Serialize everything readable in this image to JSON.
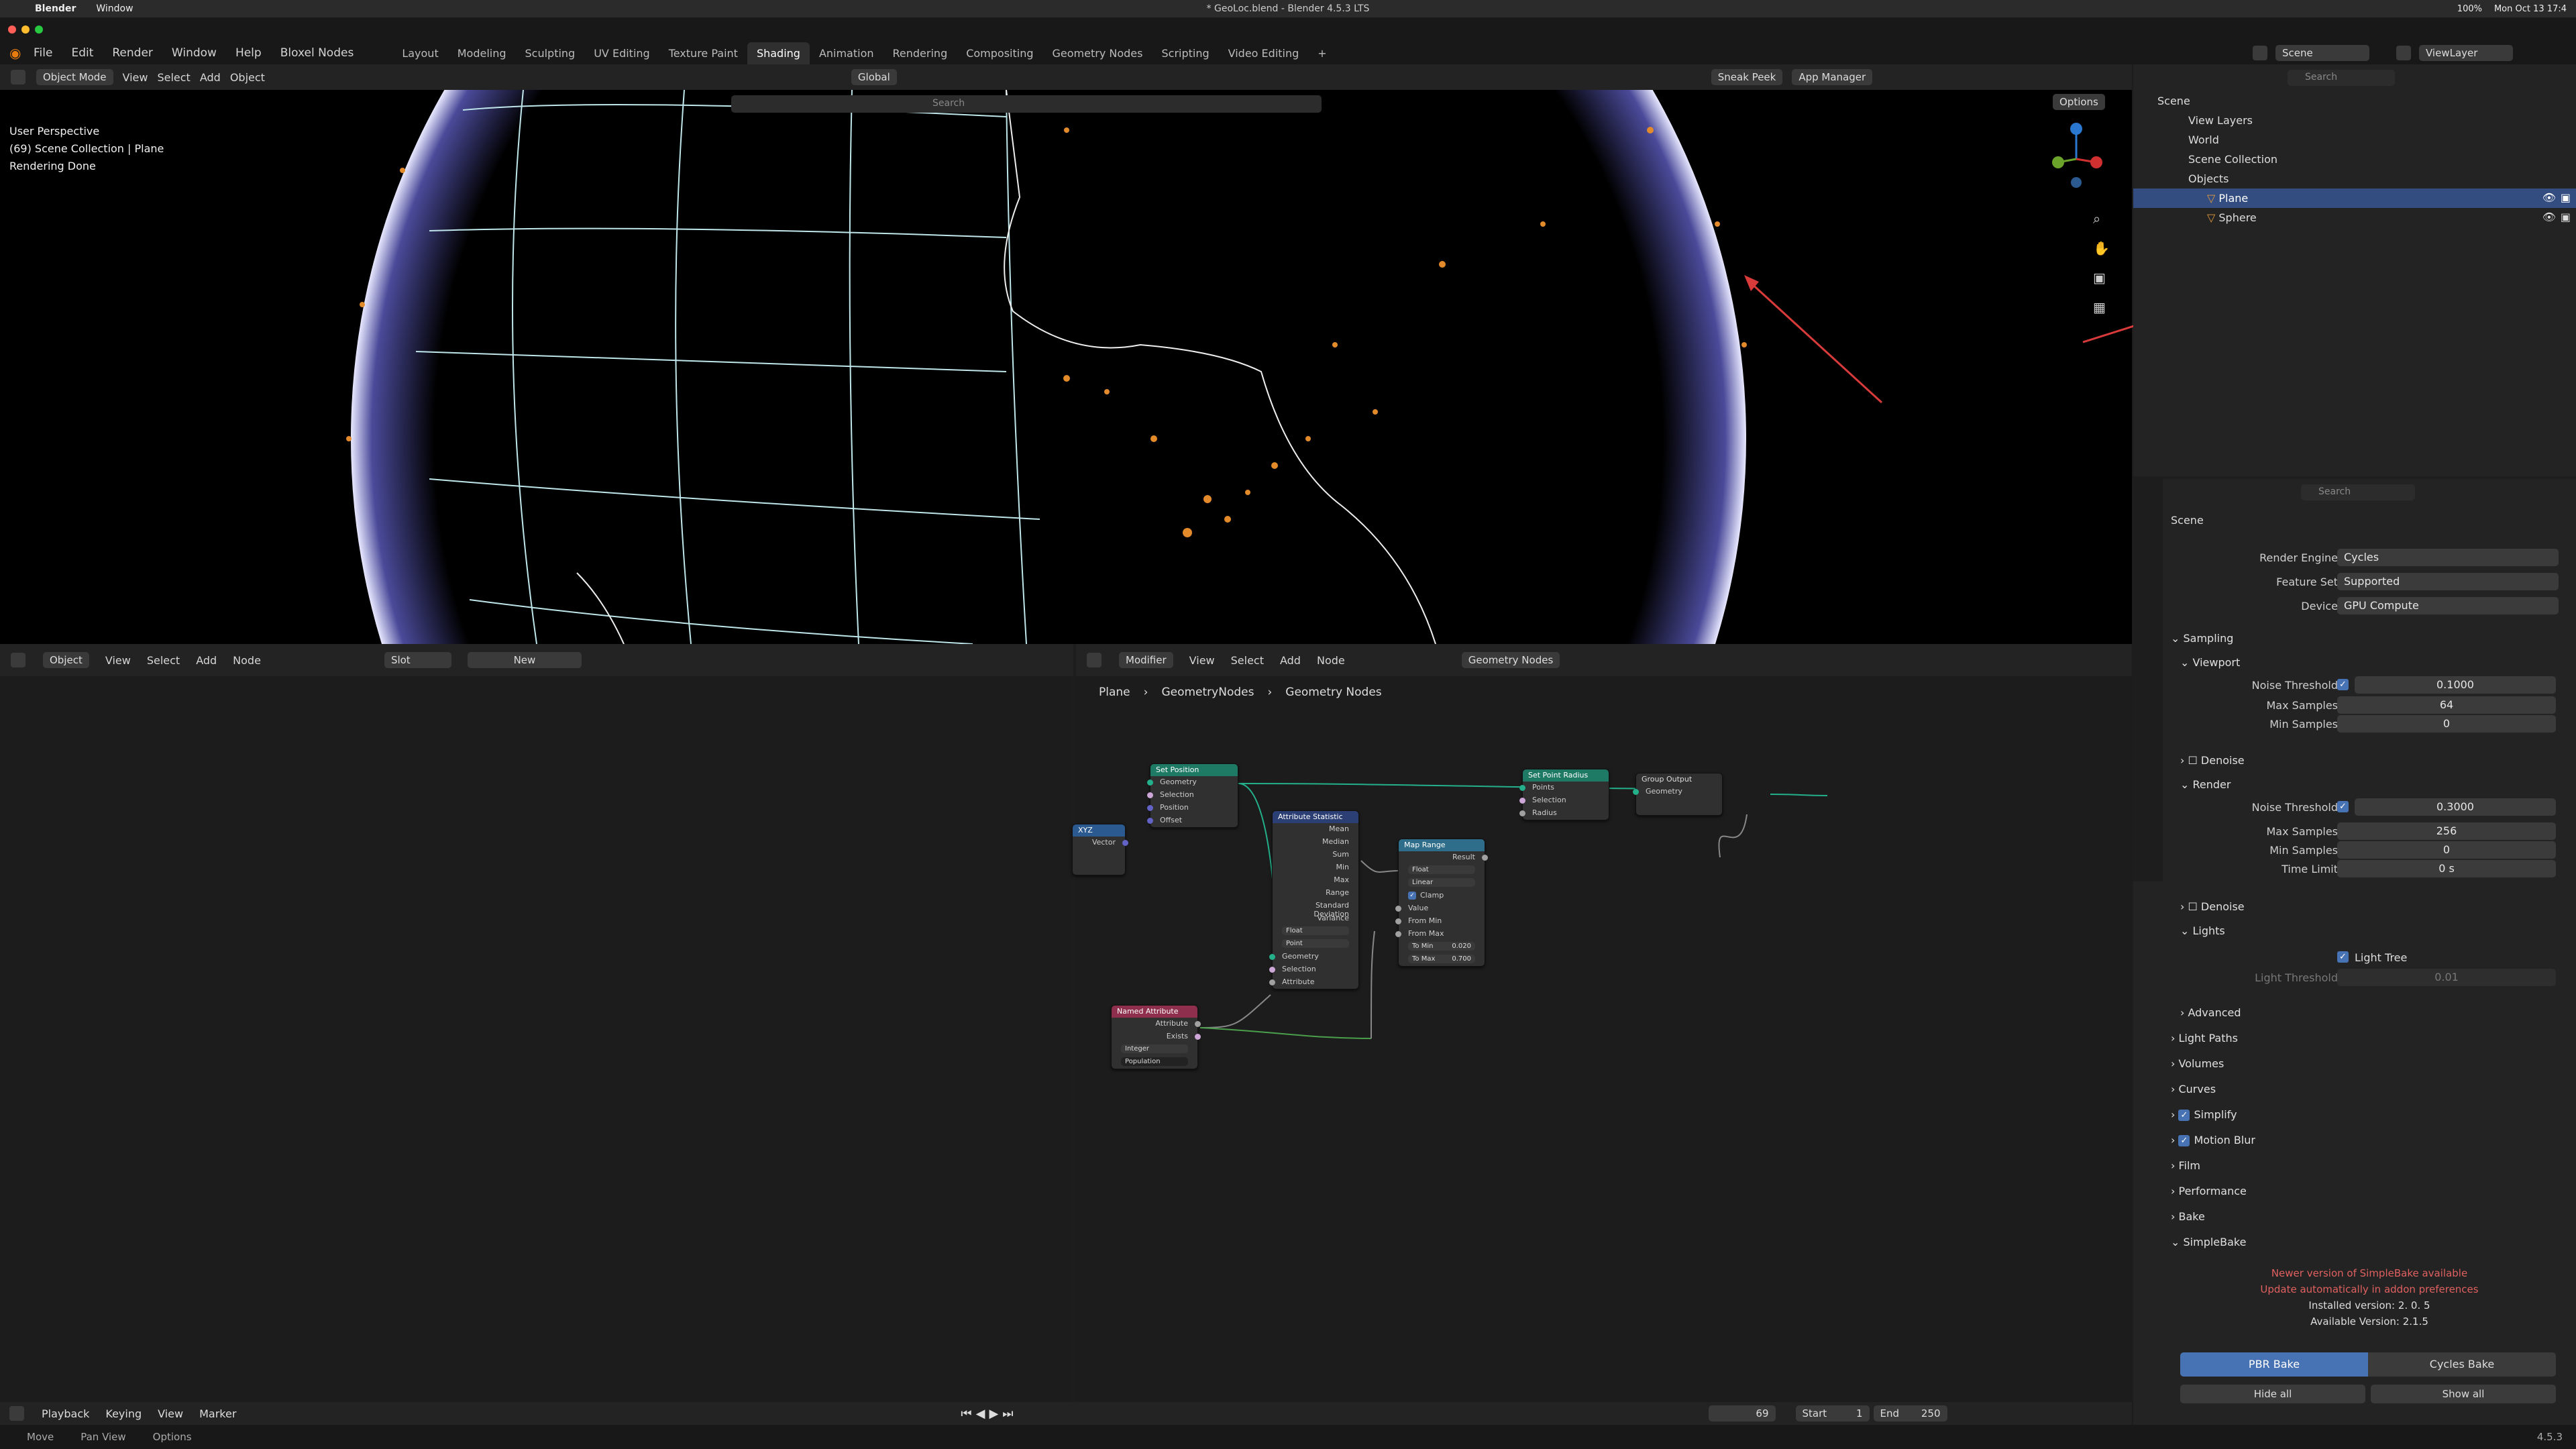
{
  "mac_menubar": {
    "app": "Blender",
    "menu": "Window",
    "window_title": "* GeoLoc.blend - Blender 4.5.3 LTS",
    "clock": "Mon Oct 13  17:4",
    "battery": "100%"
  },
  "topbar": {
    "menus": [
      "File",
      "Edit",
      "Render",
      "Window",
      "Help",
      "Bloxel Nodes"
    ],
    "workspaces": [
      "Layout",
      "Modeling",
      "Sculpting",
      "UV Editing",
      "Texture Paint",
      "Shading",
      "Animation",
      "Rendering",
      "Compositing",
      "Geometry Nodes",
      "Scripting",
      "Video Editing"
    ],
    "active_workspace": "Shading",
    "add_tab": "+",
    "scene": "Scene",
    "view_layer": "ViewLayer"
  },
  "viewport_header": {
    "mode": "Object Mode",
    "menus": [
      "View",
      "Select",
      "Add",
      "Object"
    ],
    "transform": "Global",
    "sneak_peek": "Sneak Peek",
    "app_manager": "App Manager",
    "search_placeholder": "Search",
    "options": "Options"
  },
  "viewport_overlay": {
    "line1": "User Perspective",
    "line2": "(69) Scene Collection | Plane",
    "line3": "Rendering Done"
  },
  "shader_editor": {
    "object_label": "Object",
    "menus": [
      "View",
      "Select",
      "Add",
      "Node"
    ],
    "slot": "Slot",
    "new": "New"
  },
  "geo_editor": {
    "modifier": "Modifier",
    "menus": [
      "View",
      "Select",
      "Add",
      "Node"
    ],
    "tree_name": "Geometry Nodes",
    "breadcrumb": [
      "Plane",
      "GeometryNodes",
      "Geometry Nodes"
    ]
  },
  "nodes": {
    "set_position": {
      "title": "Set Position",
      "rows": [
        "Geometry",
        "Geometry",
        "Selection",
        "Position",
        "Offset"
      ]
    },
    "vec_node": {
      "title": "XYZ",
      "rows": [
        "Vector"
      ]
    },
    "attr_stat": {
      "title": "Attribute Statistic",
      "outputs": [
        "Mean",
        "Median",
        "Sum",
        "Min",
        "Max",
        "Range",
        "Standard Deviation",
        "Variance"
      ],
      "dropdowns": [
        "Float",
        "Point"
      ],
      "inputs": [
        "Geometry",
        "Selection",
        "Attribute"
      ]
    },
    "map_range": {
      "title": "Map Range",
      "out": "Result",
      "dropdowns": [
        "Float",
        "Linear"
      ],
      "clamp": "Clamp",
      "inputs": [
        "Value",
        "From Min",
        "From Max"
      ],
      "to_min_label": "To Min",
      "to_min": "0.020",
      "to_max_label": "To Max",
      "to_max": "0.700"
    },
    "set_point_radius": {
      "title": "Set Point Radius",
      "rows": [
        "Points",
        "Points",
        "Selection",
        "Radius"
      ]
    },
    "group_output": {
      "title": "Group Output",
      "rows": [
        "Geometry"
      ]
    },
    "named_attr": {
      "title": "Named Attribute",
      "outputs": [
        "Attribute",
        "Exists"
      ],
      "type": "Integer",
      "name": "Population"
    }
  },
  "outliner": {
    "search_placeholder": "Search",
    "items": [
      {
        "label": "Scene"
      },
      {
        "label": "View Layers"
      },
      {
        "label": "World"
      },
      {
        "label": "Scene Collection"
      },
      {
        "label": "Objects"
      },
      {
        "label": "Plane"
      },
      {
        "label": "Sphere"
      }
    ]
  },
  "properties": {
    "search_placeholder": "Search",
    "context": "Scene",
    "render_engine_label": "Render Engine",
    "render_engine": "Cycles",
    "feature_set_label": "Feature Set",
    "feature_set": "Supported",
    "device_label": "Device",
    "device": "GPU Compute",
    "sampling": "Sampling",
    "viewport": "Viewport",
    "vp_noise_label": "Noise Threshold",
    "vp_noise": "0.1000",
    "vp_max_label": "Max Samples",
    "vp_max": "64",
    "vp_min_label": "Min Samples",
    "vp_min": "0",
    "denoise": "Denoise",
    "render": "Render",
    "r_noise_label": "Noise Threshold",
    "r_noise": "0.3000",
    "r_max_label": "Max Samples",
    "r_max": "256",
    "r_min_label": "Min Samples",
    "r_min": "0",
    "time_limit_label": "Time Limit",
    "time_limit": "0 s",
    "denoise2": "Denoise",
    "lights": "Lights",
    "light_tree": "Light Tree",
    "light_threshold_label": "Light Threshold",
    "light_threshold": "0.01",
    "advanced": "Advanced",
    "light_paths": "Light Paths",
    "volumes": "Volumes",
    "curves": "Curves",
    "simplify": "Simplify",
    "motion_blur": "Motion Blur",
    "film": "Film",
    "performance": "Performance",
    "bake": "Bake",
    "simplebake": "SimpleBake",
    "sb_msg1": "Newer version of SimpleBake available",
    "sb_msg2": "Update automatically in addon preferences",
    "sb_installed": "Installed version: 2. 0. 5",
    "sb_available": "Available Version: 2.1.5",
    "pbr_bake": "PBR Bake",
    "cycles_bake": "Cycles Bake",
    "hide_all": "Hide all",
    "show_all": "Show all"
  },
  "timeline": {
    "menus": [
      "Playback",
      "Keying",
      "View",
      "Marker"
    ],
    "current_frame": "69",
    "start_label": "Start",
    "start": "1",
    "end_label": "End",
    "end": "250"
  },
  "statusbar": {
    "items": [
      "Move",
      "Pan View",
      "Options"
    ],
    "version": "4.5.3"
  },
  "colors": {
    "accent": "#4772b3",
    "geo_node_header": "#1f7a65",
    "attr_stat_header": "#2b3f74",
    "map_range_header": "#2f6e8a",
    "named_attr_header": "#8f2f4e",
    "points": "#e38a2b",
    "warning_text": "#e06060",
    "arrow": "#d93a3a"
  }
}
